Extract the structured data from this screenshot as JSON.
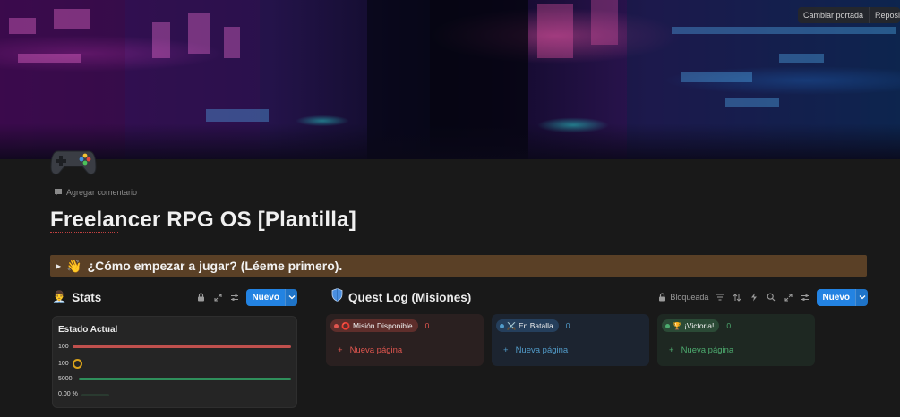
{
  "cover": {
    "buttons": [
      "Cambiar portada",
      "Reposicionar"
    ]
  },
  "page": {
    "icon": "game-controller-icon",
    "add_comment": "Agregar comentario",
    "title": "Freelancer RPG OS [Plantilla]"
  },
  "toggle": {
    "emoji": "👋",
    "text": "¿Cómo empezar a jugar? (Léeme primero)."
  },
  "stats": {
    "emoji": "👨‍💼",
    "title": "Stats",
    "new_button": "Nuevo",
    "card": {
      "title": "Estado Actual",
      "rows": [
        {
          "label": "100",
          "kind": "bar",
          "color": "#c0504d",
          "fill": 1.0
        },
        {
          "label": "100",
          "kind": "ring",
          "color": "#d9a21b",
          "fill": 1.0
        },
        {
          "label": "5000",
          "kind": "bar",
          "color": "#2f8f5b",
          "fill": 1.0
        },
        {
          "label": "0,00 %",
          "kind": "bar",
          "color": "#2f8f5b",
          "fill": 0.0
        }
      ]
    }
  },
  "quest": {
    "icon": "shield-icon",
    "title": "Quest Log (Misiones)",
    "locked_label": "Bloqueada",
    "new_button": "Nuevo",
    "columns": [
      {
        "emoji": "⭕",
        "label": "Misión Disponible",
        "count": "0",
        "new_page": "Nueva página",
        "accent": "#e0564f"
      },
      {
        "emoji": "⚔️",
        "label": "En Batalla",
        "count": "0",
        "new_page": "Nueva página",
        "accent": "#529cca"
      },
      {
        "emoji": "🏆",
        "label": "¡Victoria!",
        "count": "0",
        "new_page": "Nueva página",
        "accent": "#4dab6f"
      }
    ]
  }
}
